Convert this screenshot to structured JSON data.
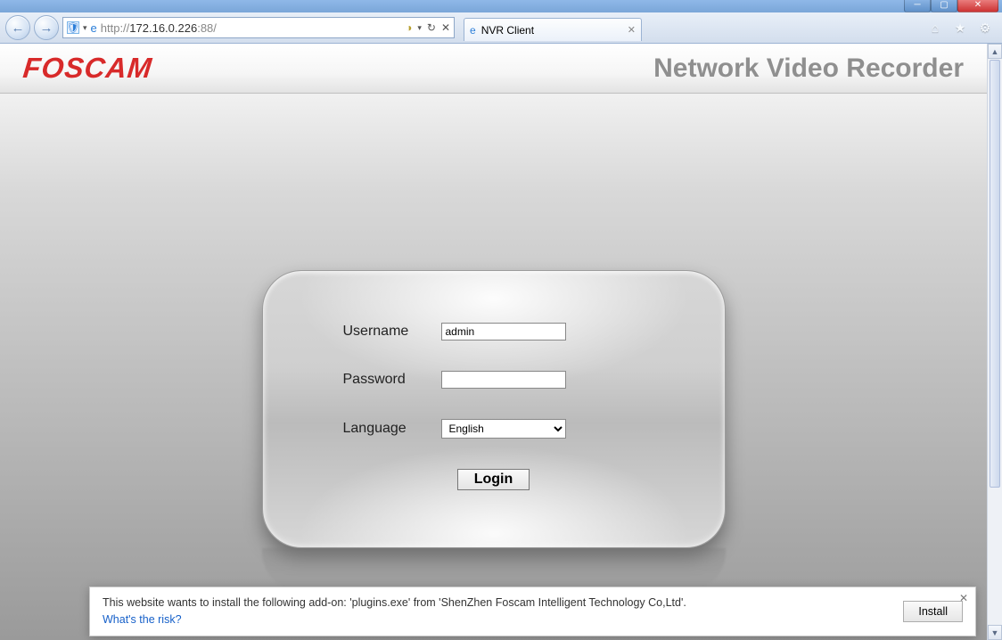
{
  "browser": {
    "url_prefix": "http://",
    "url_host": "172.16.0.226",
    "url_port": ":88/",
    "tab_title": "NVR Client"
  },
  "header": {
    "logo_text": "FOSCAM",
    "title": "Network Video Recorder"
  },
  "login": {
    "username_label": "Username",
    "username_value": "admin",
    "password_label": "Password",
    "password_value": "",
    "language_label": "Language",
    "language_value": "English",
    "language_options": [
      "English"
    ],
    "button_label": "Login"
  },
  "notification": {
    "message": "This website wants to install the following add-on: 'plugins.exe' from 'ShenZhen Foscam Intelligent Technology Co,Ltd'.",
    "link_text": "What's the risk?",
    "install_label": "Install"
  }
}
